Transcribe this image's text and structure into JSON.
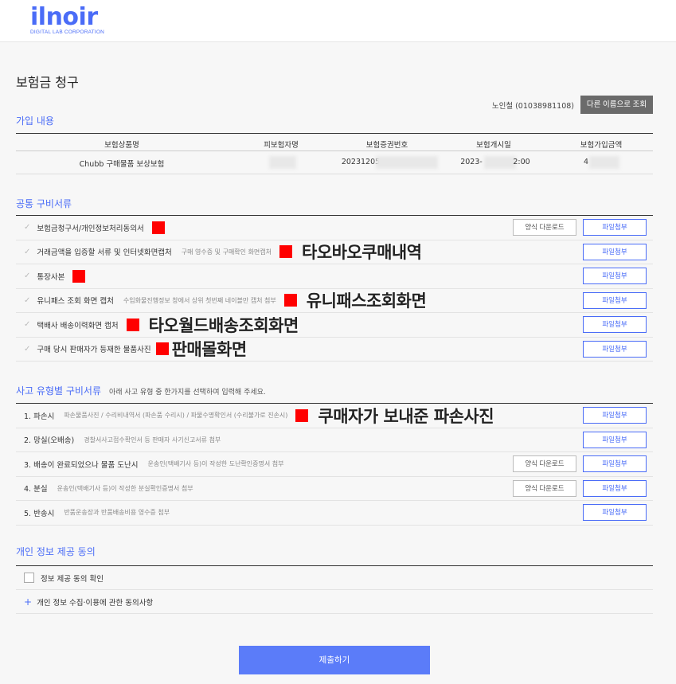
{
  "logo": {
    "main": "ilnoir",
    "sub": "DIGITAL LAB CORPORATION"
  },
  "page_title": "보험금 청구",
  "user": {
    "info": "노인철 (01038981108)",
    "lookup_button": "다른 이름으로 조회"
  },
  "subscription": {
    "title": "가입 내용",
    "headers": [
      "보험상품명",
      "피보험자명",
      "보험증권번호",
      "보험개시일",
      "보험가입금액"
    ],
    "row": {
      "product": "Chubb 구매물품 보상보험",
      "policy_no": "20231205",
      "start_date_a": "2023-",
      "start_date_b": "2:00",
      "amount": "4"
    }
  },
  "common_docs": {
    "title": "공통 구비서류",
    "items": [
      {
        "label": "보험금청구서/개인정보처리동의서",
        "desc": "",
        "annotation": "",
        "download": "양식 다운로드",
        "attach": "파일첨부"
      },
      {
        "label": "거래금액을 입증할 서류 및 인터넷화면캡처",
        "desc": "구매 영수증 및 구매확인 화면캡처",
        "annotation": "타오바오쿠매내역",
        "download": "",
        "attach": "파일첨부"
      },
      {
        "label": "통장사본",
        "desc": "",
        "annotation": "",
        "download": "",
        "attach": "파일첨부"
      },
      {
        "label": "유니패스 조회 화면 캡처",
        "desc": "수입화물진행정보 창에서 상위 첫번째 네이블만 캡처 첨부",
        "annotation": "유니패스조회화면",
        "download": "",
        "attach": "파일첨부"
      },
      {
        "label": "택배사 배송이력화면 캡처",
        "desc": "",
        "annotation": "타오월드배송조회화면",
        "download": "",
        "attach": "파일첨부"
      },
      {
        "label": "구매 당시 판매자가 등재한 물품사진",
        "desc": "",
        "annotation": "판매몰화면",
        "download": "",
        "attach": "파일첨부"
      }
    ]
  },
  "accident_docs": {
    "title": "사고 유형별 구비서류",
    "desc": "아래 사고 유형 중 한가지를 선택하여 입력해 주세요.",
    "items": [
      {
        "label": "1. 파손시",
        "desc": "파손물품사진 / 수리비내역서 (파손품 수리시) / 파물수명확인서 (수리불가로 진손시)",
        "annotation": "쿠매자가 보내준 파손사진",
        "download": "",
        "attach": "파일첨부"
      },
      {
        "label": "2. 망실(오배송)",
        "desc": "경찰서사고접수확인서 등 판매자 사기신고서류 첨부",
        "annotation": "",
        "download": "",
        "attach": "파일첨부"
      },
      {
        "label": "3. 배송이 완료되었으나 물품 도난시",
        "desc": "운송인(택배기사 등)이 작성한 도난확인증명서 첨부",
        "annotation": "",
        "download": "양식 다운로드",
        "attach": "파일첨부"
      },
      {
        "label": "4. 분실",
        "desc": "운송인(택배기사 등)이 작성한 분실확인증명서 첨부",
        "annotation": "",
        "download": "양식 다운로드",
        "attach": "파일첨부"
      },
      {
        "label": "5. 반송시",
        "desc": "반품운송장과 반품배송비용 영수증 첨부",
        "annotation": "",
        "download": "",
        "attach": "파일첨부"
      }
    ]
  },
  "consent": {
    "title": "개인 정보 제공 동의",
    "confirm": "정보 제공 동의 확인",
    "detail": "개인 정보 수집·이용에 관한 동의사항"
  },
  "submit": "제출하기",
  "colors": {
    "accent": "#4a6cf7",
    "submit": "#5b7cf9",
    "annotation_box": "#ff0000"
  }
}
